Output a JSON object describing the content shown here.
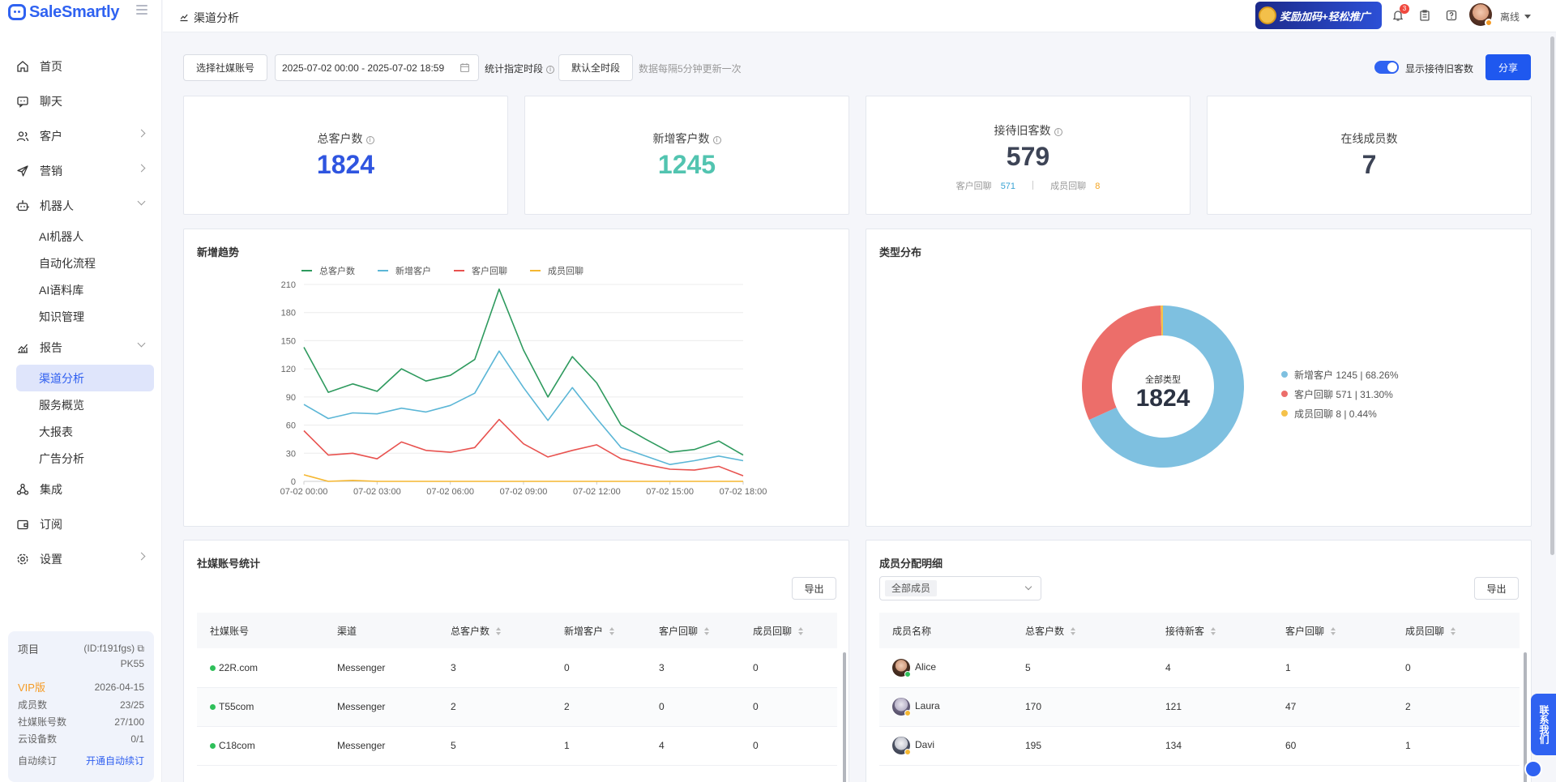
{
  "app": {
    "brand": "SaleSmartly"
  },
  "sidebar": {
    "items": [
      {
        "label": "首页",
        "icon": "home-icon"
      },
      {
        "label": "聊天",
        "icon": "chat-icon"
      },
      {
        "label": "客户",
        "icon": "users-icon"
      },
      {
        "label": "营销",
        "icon": "send-icon"
      },
      {
        "label": "机器人",
        "icon": "robot-icon"
      },
      {
        "label": "报告",
        "icon": "report-icon"
      },
      {
        "label": "集成",
        "icon": "integration-icon"
      },
      {
        "label": "订阅",
        "icon": "wallet-icon"
      },
      {
        "label": "设置",
        "icon": "gear-icon"
      }
    ],
    "robot_sub": [
      "AI机器人",
      "自动化流程",
      "AI语料库",
      "知识管理"
    ],
    "report_sub": [
      "渠道分析",
      "服务概览",
      "大报表",
      "广告分析"
    ],
    "plan": {
      "project_label": "项目",
      "project_id": "(ID:f191fgs)",
      "project_name": "PK55",
      "tier": "VIP版",
      "expire": "2026-04-15",
      "members_label": "成员数",
      "members_val": "23/25",
      "accounts_label": "社媒账号数",
      "accounts_val": "27/100",
      "cloud_label": "云设备数",
      "cloud_val": "0/1",
      "renew_label": "自动续订",
      "renew_link": "开通自动续订"
    }
  },
  "topbar": {
    "breadcrumb": "渠道分析",
    "promo": "奖励加码+轻松推广",
    "notif_count": "3",
    "status": "离线"
  },
  "filters": {
    "select_account": "选择社媒账号",
    "date_range": "2025-07-02 00:00 - 2025-07-02 18:59",
    "period_label": "统计指定时段",
    "period_value": "默认全时段",
    "update_hint": "数据每隔5分钟更新一次",
    "toggle_label": "显示接待旧客数",
    "share": "分享"
  },
  "stats": {
    "total_label": "总客户数",
    "total_value": "1824",
    "new_label": "新增客户数",
    "new_value": "1245",
    "old_label": "接待旧客数",
    "old_value": "579",
    "old_customer_label": "客户回聊",
    "old_customer_value": "571",
    "old_member_label": "成员回聊",
    "old_member_value": "8",
    "online_label": "在线成员数",
    "online_value": "7"
  },
  "trend": {
    "title": "新增趋势",
    "legend": [
      "总客户数",
      "新增客户",
      "客户回聊",
      "成员回聊"
    ],
    "colors": [
      "#2e9a5e",
      "#5bb6d6",
      "#e8524f",
      "#f5b731"
    ]
  },
  "chart_data": {
    "type": "line",
    "x": [
      "07-02 00:00",
      "07-02 01:00",
      "07-02 02:00",
      "07-02 03:00",
      "07-02 04:00",
      "07-02 05:00",
      "07-02 06:00",
      "07-02 07:00",
      "07-02 08:00",
      "07-02 09:00",
      "07-02 10:00",
      "07-02 11:00",
      "07-02 12:00",
      "07-02 13:00",
      "07-02 14:00",
      "07-02 15:00",
      "07-02 16:00",
      "07-02 17:00",
      "07-02 18:00"
    ],
    "xticks": [
      "07-02 00:00",
      "07-02 03:00",
      "07-02 06:00",
      "07-02 09:00",
      "07-02 12:00",
      "07-02 15:00",
      "07-02 18:00"
    ],
    "yticks": [
      0,
      30,
      60,
      90,
      120,
      150,
      180,
      210
    ],
    "ylim": [
      0,
      210
    ],
    "series": [
      {
        "name": "总客户数",
        "values": [
          143,
          95,
          104,
          96,
          120,
          107,
          113,
          130,
          205,
          140,
          90,
          133,
          105,
          60,
          45,
          31,
          34,
          43,
          28
        ]
      },
      {
        "name": "新增客户",
        "values": [
          82,
          67,
          73,
          72,
          78,
          74,
          81,
          94,
          139,
          100,
          65,
          100,
          67,
          36,
          27,
          18,
          22,
          27,
          22
        ]
      },
      {
        "name": "客户回聊",
        "values": [
          54,
          28,
          30,
          24,
          42,
          33,
          31,
          36,
          66,
          40,
          26,
          33,
          39,
          24,
          18,
          13,
          12,
          16,
          6
        ]
      },
      {
        "name": "成员回聊",
        "values": [
          7,
          0,
          1,
          0,
          0,
          0,
          0,
          0,
          0,
          0,
          0,
          0,
          0,
          0,
          0,
          0,
          0,
          0,
          0
        ]
      }
    ]
  },
  "pie": {
    "title": "类型分布",
    "center_label": "全部类型",
    "center_value": "1824",
    "items": [
      {
        "label": "新增客户 1245 | 68.26%",
        "value": 1245,
        "color": "#7ec0e0"
      },
      {
        "label": "客户回聊 571 | 31.30%",
        "value": 571,
        "color": "#ec6e6a"
      },
      {
        "label": "成员回聊 8 | 0.44%",
        "value": 8,
        "color": "#f5c24a"
      }
    ]
  },
  "social_table": {
    "title": "社媒账号统计",
    "export": "导出",
    "headers": [
      "社媒账号",
      "渠道",
      "总客户数",
      "新增客户",
      "客户回聊",
      "成员回聊"
    ],
    "rows": [
      [
        "22R.com",
        "Messenger",
        "3",
        "0",
        "3",
        "0"
      ],
      [
        "T55com",
        "Messenger",
        "2",
        "2",
        "0",
        "0"
      ],
      [
        "C18com",
        "Messenger",
        "5",
        "1",
        "4",
        "0"
      ]
    ]
  },
  "member_table": {
    "title": "成员分配明细",
    "export": "导出",
    "filter": "全部成员",
    "headers": [
      "成员名称",
      "总客户数",
      "接待新客",
      "客户回聊",
      "成员回聊"
    ],
    "rows": [
      [
        "Alice",
        "5",
        "4",
        "1",
        "0"
      ],
      [
        "Laura",
        "170",
        "121",
        "47",
        "2"
      ],
      [
        "Davi",
        "195",
        "134",
        "60",
        "1"
      ]
    ],
    "status_colors": [
      "#2fbf5a",
      "#f5b731",
      "#f5b731"
    ]
  },
  "contact": "联系我们"
}
